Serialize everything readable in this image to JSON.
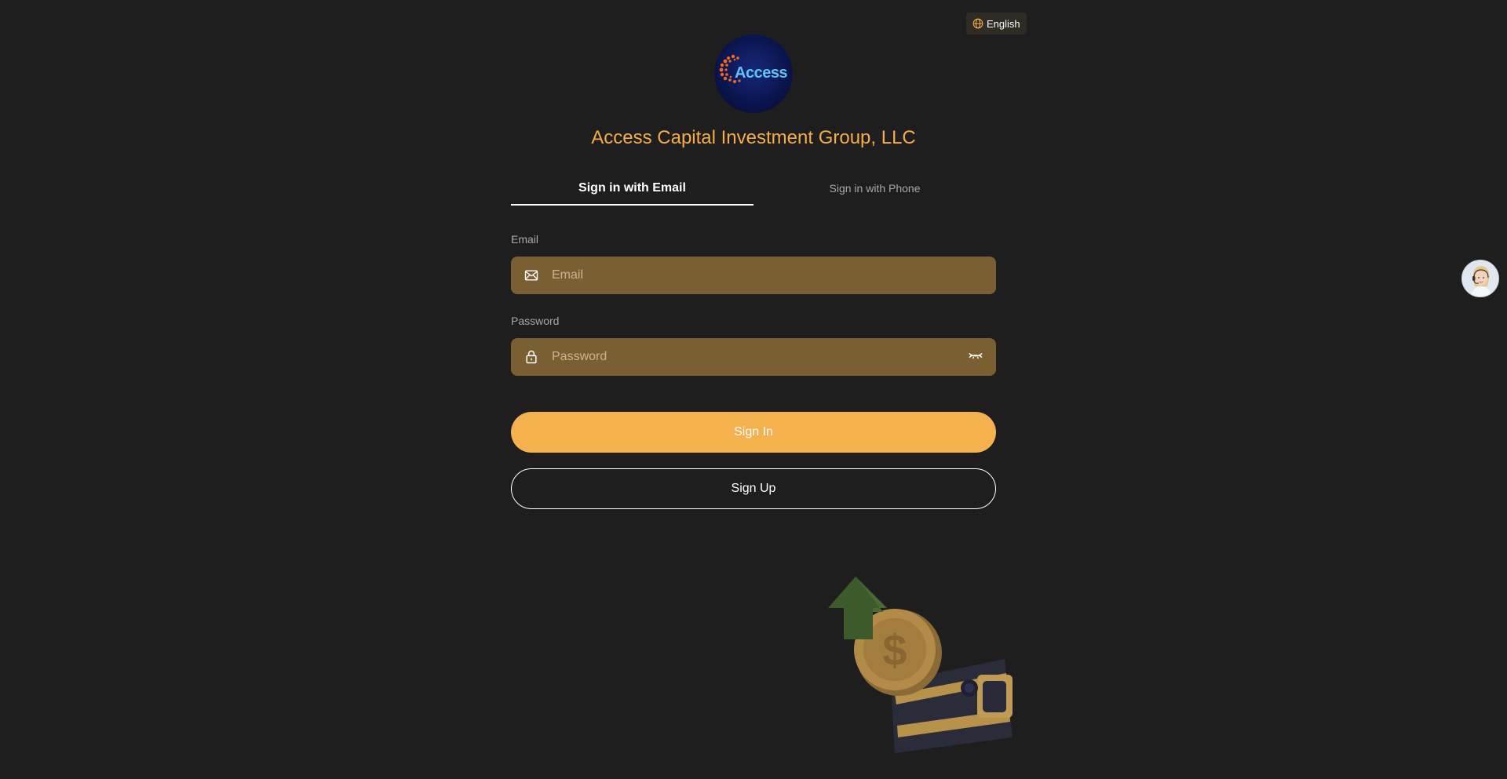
{
  "language": {
    "label": "English",
    "icon": "globe-icon"
  },
  "logo": {
    "text": "Access"
  },
  "company": {
    "name": "Access Capital Investment Group, LLC"
  },
  "tabs": [
    {
      "label": "Sign in with Email",
      "active": true
    },
    {
      "label": "Sign in with Phone",
      "active": false
    }
  ],
  "email": {
    "label": "Email",
    "placeholder": "Email",
    "value": "",
    "icon": "mail-icon"
  },
  "password": {
    "label": "Password",
    "placeholder": "Password",
    "value": "",
    "icon": "lock-icon",
    "toggle_icon": "eye-closed-icon"
  },
  "actions": {
    "signin_label": "Sign In",
    "signup_label": "Sign Up"
  },
  "support": {
    "icon": "support-agent-avatar"
  },
  "colors": {
    "background": "#1e1e1e",
    "accent": "#f6b04e",
    "title": "#f6ad45",
    "input_bg": "#7a5f33"
  }
}
